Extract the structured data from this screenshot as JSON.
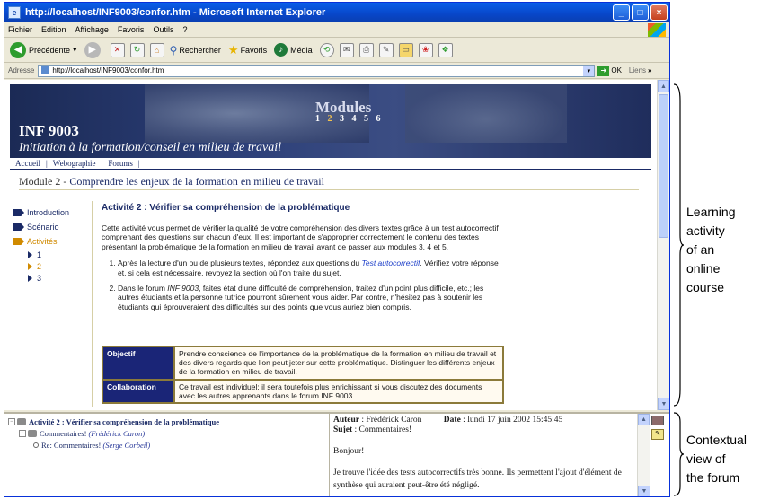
{
  "window": {
    "title": "http://localhost/INF9003/confor.htm - Microsoft Internet Explorer"
  },
  "menu": [
    "Fichier",
    "Edition",
    "Affichage",
    "Favoris",
    "Outils",
    "?"
  ],
  "toolbar": {
    "back": "Précédente",
    "search": "Rechercher",
    "favorites": "Favoris",
    "media": "Média"
  },
  "address": {
    "label": "Adresse",
    "url": "http://localhost/INF9003/confor.htm",
    "go": "OK",
    "links": "Liens"
  },
  "banner": {
    "code": "INF 9003",
    "title": "Initiation à la formation/conseil en milieu de travail",
    "modules_word": "Modules",
    "modules_nums": [
      "1",
      "2",
      "3",
      "4",
      "5",
      "6"
    ],
    "current_module": "2"
  },
  "nav": [
    "Accueil",
    "Webographie",
    "Forums"
  ],
  "module": {
    "label": "Module 2 -",
    "title": "Comprendre les enjeux de la formation en milieu de travail"
  },
  "leftnav": {
    "items": [
      "Introduction",
      "Scénario",
      "Activités"
    ],
    "subs": [
      "1",
      "2",
      "3"
    ]
  },
  "activity": {
    "title": "Activité 2 : Vérifier sa compréhension de la problématique",
    "intro": "Cette activité vous permet de vérifier la qualité de votre compréhension des divers textes grâce à un test autocorrectif comprenant des questions sur chacun d'eux. Il est important de s'approprier correctement le contenu des textes présentant la problématique de la formation en milieu de travail avant de passer aux modules 3, 4 et 5.",
    "step1_a": "Après la lecture d'un ou de plusieurs textes, répondez aux questions du ",
    "step1_link": "Test autocorrectif",
    "step1_b": ". Vérifiez votre réponse et, si cela est nécessaire, revoyez la section où l'on traite du sujet.",
    "step2_a": "Dans le forum ",
    "step2_em": "INF 9003",
    "step2_b": ", faites état d'une difficulté de compréhension, traitez d'un point plus difficile, etc.; les autres étudiants et la personne tutrice pourront sûrement vous aider. Par contre, n'hésitez pas à soutenir les étudiants qui éprouveraient des difficultés sur des points que vous auriez bien compris."
  },
  "table": {
    "rows": [
      {
        "head": "Objectif",
        "body": "Prendre conscience de l'importance de la problématique de la formation en milieu de travail et des divers regards que l'on peut jeter sur cette problématique. Distinguer les différents enjeux de la formation en milieu de travail."
      },
      {
        "head": "Collaboration",
        "body": "Ce travail est individuel; il sera toutefois plus enrichissant si vous discutez des documents avec les autres apprenants dans le forum INF 9003."
      }
    ]
  },
  "forum": {
    "thread_title": "Activité 2 : Vérifier sa compréhension de la problématique",
    "reply1": "Commentaires!",
    "reply1_author": "(Frédérick Caron)",
    "reply2": "Re: Commentaires!",
    "reply2_author": "(Serge Corbeil)",
    "author_label": "Auteur",
    "author": "Frédérick Caron",
    "date_label": "Date",
    "date": "lundi 17 juin 2002 15:45:45",
    "subject_label": "Sujet",
    "subject": "Commentaires!",
    "greeting": "Bonjour!",
    "body": "Je trouve l'idée des tests autocorrectifs très bonne. Ils permettent l'ajout d'élément de synthèse qui auraient peut-être été négligé."
  },
  "annotations": {
    "learning": [
      "Learning",
      "activity",
      "of an",
      "online",
      "course"
    ],
    "forum": [
      "Contextual",
      "view of",
      "the forum"
    ]
  }
}
